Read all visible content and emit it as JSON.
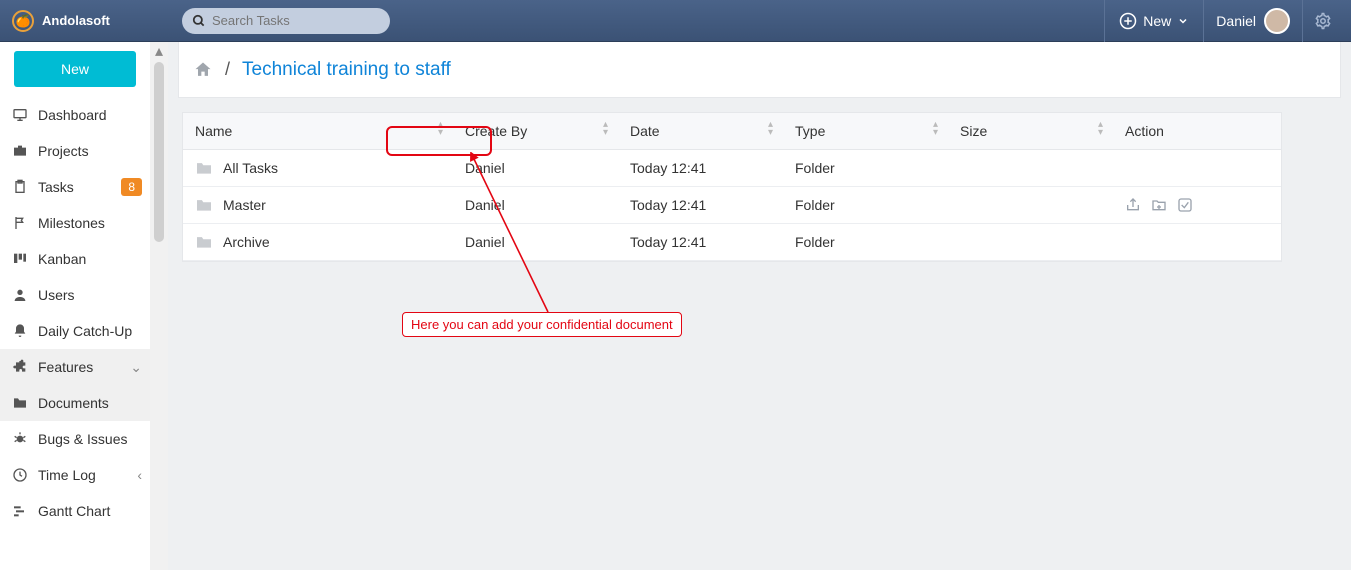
{
  "brand": "Andolasoft",
  "search_placeholder": "Search Tasks",
  "header": {
    "new_label": "New",
    "user_name": "Daniel"
  },
  "new_button": "New",
  "sidebar": [
    {
      "icon": "monitor",
      "label": "Dashboard",
      "badge": null,
      "caret": null,
      "active": false
    },
    {
      "icon": "briefcase",
      "label": "Projects",
      "badge": null,
      "caret": null,
      "active": false
    },
    {
      "icon": "clipboard",
      "label": "Tasks",
      "badge": "8",
      "caret": null,
      "active": false
    },
    {
      "icon": "milestone",
      "label": "Milestones",
      "badge": null,
      "caret": null,
      "active": false
    },
    {
      "icon": "kanban",
      "label": "Kanban",
      "badge": null,
      "caret": null,
      "active": false
    },
    {
      "icon": "user",
      "label": "Users",
      "badge": null,
      "caret": null,
      "active": false
    },
    {
      "icon": "bell",
      "label": "Daily Catch-Up",
      "badge": null,
      "caret": null,
      "active": false
    },
    {
      "icon": "puzzle",
      "label": "Features",
      "badge": null,
      "caret": "down",
      "active": true
    },
    {
      "icon": "folder",
      "label": "Documents",
      "badge": null,
      "caret": null,
      "active": true
    },
    {
      "icon": "bug",
      "label": "Bugs & Issues",
      "badge": null,
      "caret": null,
      "active": false
    },
    {
      "icon": "clock",
      "label": "Time Log",
      "badge": null,
      "caret": "left",
      "active": false
    },
    {
      "icon": "gantt",
      "label": "Gantt Chart",
      "badge": null,
      "caret": null,
      "active": false
    }
  ],
  "breadcrumbs": {
    "separator": "/",
    "current": "Technical training to staff"
  },
  "columns": {
    "name": "Name",
    "create": "Create By",
    "date": "Date",
    "type": "Type",
    "size": "Size",
    "action": "Action"
  },
  "rows": [
    {
      "name": "All Tasks",
      "create": "Daniel",
      "date": "Today 12:41",
      "type": "Folder",
      "size": "",
      "actions": false
    },
    {
      "name": "Master",
      "create": "Daniel",
      "date": "Today 12:41",
      "type": "Folder",
      "size": "",
      "actions": true
    },
    {
      "name": "Archive",
      "create": "Daniel",
      "date": "Today 12:41",
      "type": "Folder",
      "size": "",
      "actions": false
    }
  ],
  "annotation": "Here you can add your confidential document"
}
